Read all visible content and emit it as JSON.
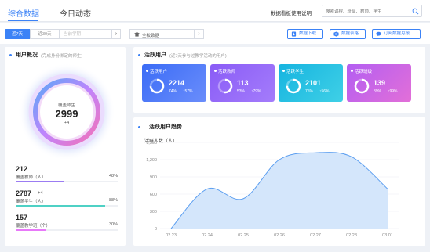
{
  "header": {
    "tabs": [
      {
        "label": "综合数据",
        "active": true
      },
      {
        "label": "今日动态",
        "active": false
      }
    ],
    "help_link": "数据看板使用说明",
    "search": {
      "placeholder": "搜索课程、班级、教师、学生"
    }
  },
  "filters": {
    "periods": [
      {
        "label": "近7天",
        "active": true
      },
      {
        "label": "近30天",
        "active": false
      },
      {
        "label": "当前学期",
        "active": false
      }
    ],
    "scope_label": "全校数据",
    "buttons": [
      {
        "label": "数据下载",
        "icon": "download-icon"
      },
      {
        "label": "数据表格",
        "icon": "table-icon"
      },
      {
        "label": "订阅数据月报",
        "icon": "subscribe-icon"
      }
    ],
    "accent": "#3b82f6"
  },
  "user_overview": {
    "title": "用户概况",
    "subtitle": "(完成身份绑定的师生)",
    "ring": {
      "label": "覆盖师生",
      "value": "2999",
      "delta": "+4"
    },
    "stats": [
      {
        "value": "212",
        "delta": "",
        "name": "覆盖教师（人）",
        "pct": "48%",
        "fraction": 0.48,
        "color": "#9b7cf2"
      },
      {
        "value": "2787",
        "delta": "+4",
        "name": "覆盖学生（人）",
        "pct": "88%",
        "fraction": 0.88,
        "color": "#4fd1c5"
      },
      {
        "value": "157",
        "delta": "",
        "name": "覆盖教学班（个）",
        "pct": "30%",
        "fraction": 0.3,
        "color": "#e879f9"
      }
    ]
  },
  "active_users": {
    "title": "活跃用户",
    "subtitle": "(近7天参与过教学活动的用户)",
    "cards": [
      {
        "title": "活跃用户",
        "value": "2214",
        "pct": "74%",
        "up": "↑57%",
        "fraction": 0.74,
        "color_from": "#3b6cf6",
        "color_to": "#6a8dfb"
      },
      {
        "title": "活跃教师",
        "value": "113",
        "pct": "53%",
        "up": "↑79%",
        "fraction": 0.53,
        "color_from": "#8a5cf6",
        "color_to": "#a47cfb"
      },
      {
        "title": "活跃学生",
        "value": "2101",
        "pct": "75%",
        "up": "↑56%",
        "fraction": 0.75,
        "color_from": "#16b4e0",
        "color_to": "#3fd0e6"
      },
      {
        "title": "活跃班级",
        "value": "139",
        "pct": "89%",
        "up": "↑99%",
        "fraction": 0.89,
        "color_from": "#b35ef2",
        "color_to": "#e26fd8"
      }
    ]
  },
  "trend": {
    "title": "活跃用户趋势"
  },
  "chart_data": {
    "type": "area",
    "title": "活跃用户趋势",
    "ylabel": "活跃人数（人）",
    "xlabel": "",
    "x": [
      "02.23",
      "02.24",
      "02.25",
      "02.26",
      "02.27",
      "02.28",
      "03.01"
    ],
    "values": [
      0,
      690,
      520,
      1200,
      1320,
      1250,
      690
    ],
    "ylim": [
      0,
      1500
    ],
    "yticks": [
      "0",
      "300",
      "600",
      "900",
      "1,200",
      "1,500"
    ],
    "yticks_values": [
      0,
      300,
      600,
      900,
      1200,
      1500
    ],
    "grid": true,
    "line_color": "#5b9ef0",
    "fill_color": "#cfe3fb"
  }
}
